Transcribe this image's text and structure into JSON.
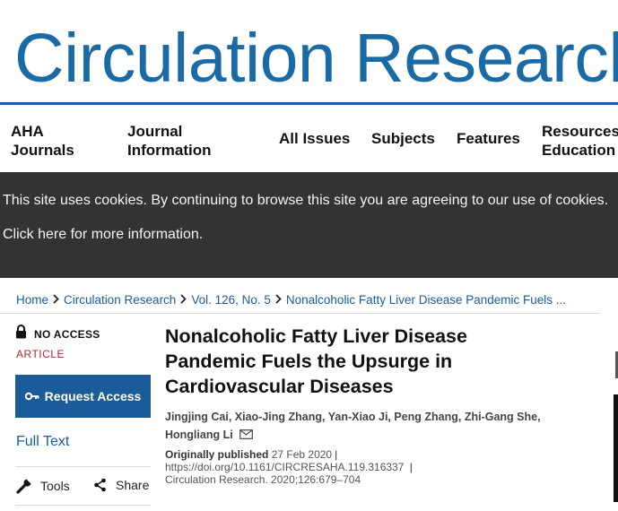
{
  "masthead": {
    "title": "Circulation Research"
  },
  "nav": {
    "items": [
      {
        "line1": "AHA",
        "line2": "Journals"
      },
      {
        "line1": "Journal",
        "line2": "Information"
      },
      {
        "label": "All Issues"
      },
      {
        "label": "Subjects"
      },
      {
        "label": "Features"
      },
      {
        "line1": "Resources &",
        "line2": "Education"
      }
    ]
  },
  "cookie": {
    "message": "This site uses cookies. By continuing to browse this site you are agreeing to our use of cookies.",
    "link": "Click here for more information."
  },
  "breadcrumb": {
    "items": [
      "Home",
      "Circulation Research",
      "Vol. 126, No. 5",
      "Nonalcoholic Fatty Liver Disease Pandemic Fuels ..."
    ]
  },
  "sidebar": {
    "access": "NO ACCESS",
    "article_label": "ARTICLE",
    "request_button": "Request Access",
    "full_text": "Full Text",
    "tools": "Tools",
    "share": "Share"
  },
  "article": {
    "title": "Nonalcoholic Fatty Liver Disease Pandemic Fuels the Upsurge in Cardiovascular Diseases",
    "authors_line1": "Jingjing Cai, Xiao-Jing Zhang, Yan-Xiao Ji, Peng Zhang, Zhi-Gang She,",
    "authors_line2": "Hongliang Li",
    "published_label": "Originally published",
    "published_date": "27 Feb 2020",
    "doi": "https://doi.org/10.1161/CIRCRESAHA.119.316337",
    "citation": "Circulation Research. 2020;126:679–704"
  },
  "colors": {
    "brand_blue": "#1a6aa6",
    "link_blue": "#1a5c9a",
    "cookie_bg": "#333333",
    "article_red": "#b5232c"
  }
}
